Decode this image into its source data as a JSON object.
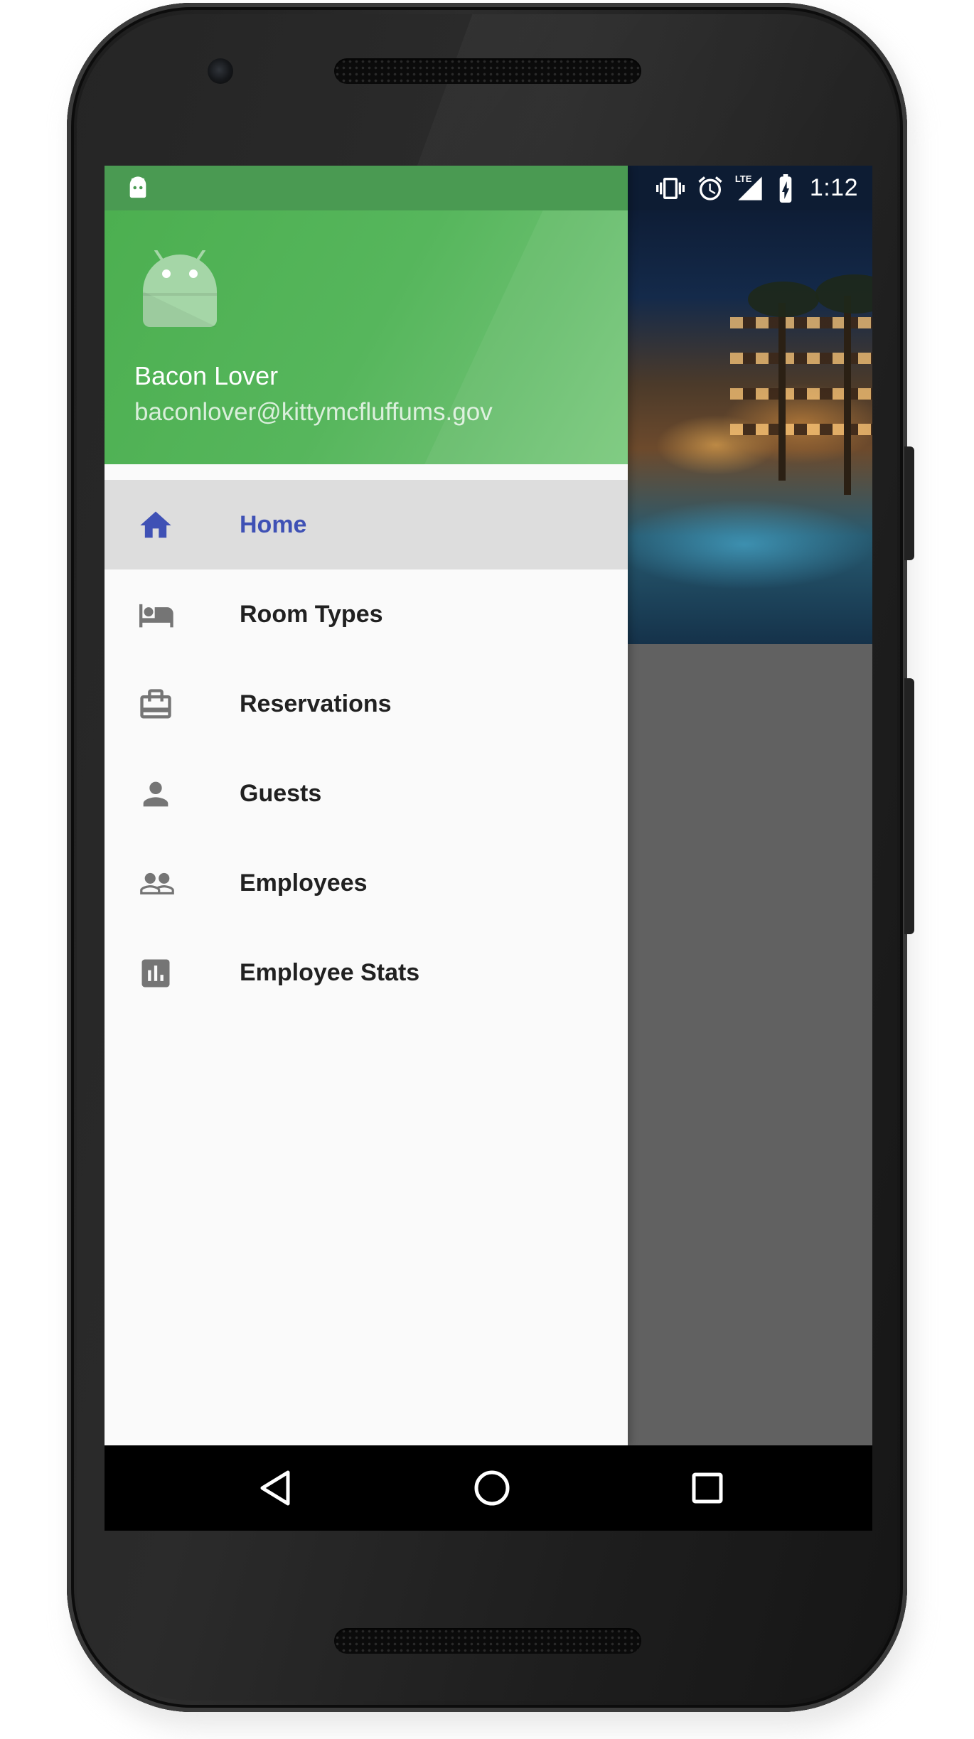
{
  "status_bar": {
    "time": "1:12",
    "network_label": "LTE"
  },
  "drawer": {
    "header": {
      "name": "Bacon Lover",
      "email": "baconlover@kittymcfluffums.gov"
    },
    "items": [
      {
        "label": "Home",
        "icon": "home-icon",
        "active": true
      },
      {
        "label": "Room Types",
        "icon": "bed-icon",
        "active": false
      },
      {
        "label": "Reservations",
        "icon": "briefcase-icon",
        "active": false
      },
      {
        "label": "Guests",
        "icon": "person-icon",
        "active": false
      },
      {
        "label": "Employees",
        "icon": "people-icon",
        "active": false
      },
      {
        "label": "Employee Stats",
        "icon": "bar-chart-icon",
        "active": false
      }
    ]
  },
  "colors": {
    "accent": "#3f51b5",
    "header_green": "#4caf50",
    "status_green": "#4a9a52",
    "active_item_bg": "#dddddd",
    "icon_gray": "#757575"
  }
}
